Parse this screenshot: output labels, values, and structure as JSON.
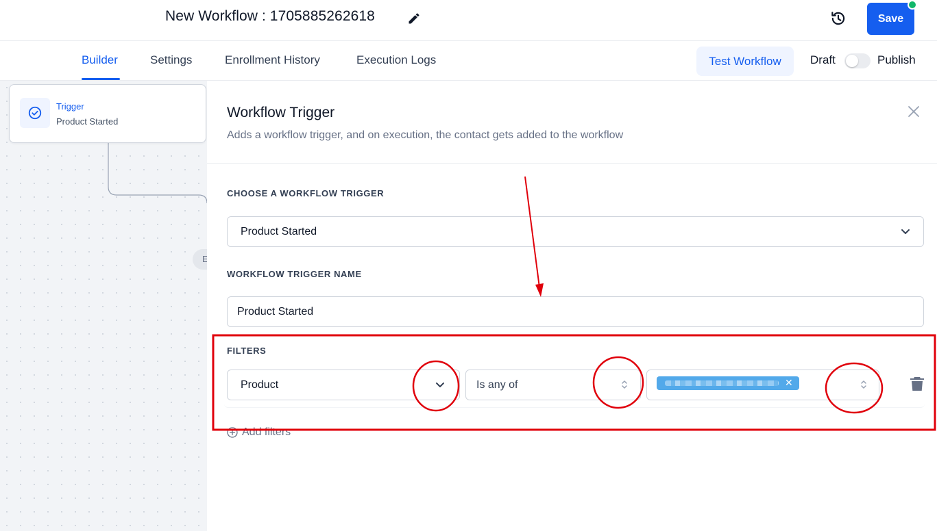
{
  "header": {
    "workflow_title": "New Workflow : 1705885262618",
    "save_label": "Save",
    "edit_icon": "pencil-icon",
    "history_icon": "history-icon"
  },
  "tabs": [
    {
      "label": "Builder",
      "active": true
    },
    {
      "label": "Settings",
      "active": false
    },
    {
      "label": "Enrollment History",
      "active": false
    },
    {
      "label": "Execution Logs",
      "active": false
    }
  ],
  "toolbar": {
    "test_workflow_label": "Test Workflow",
    "draft_label": "Draft",
    "publish_label": "Publish",
    "published": false
  },
  "canvas": {
    "trigger_node": {
      "title": "Trigger",
      "subtitle": "Product Started",
      "icon": "check-circle-icon"
    },
    "next_node_pill": "E"
  },
  "panel": {
    "title": "Workflow Trigger",
    "description": "Adds a workflow trigger, and on execution, the contact gets added to the workflow",
    "choose_trigger_label": "CHOOSE A WORKFLOW TRIGGER",
    "choose_trigger_value": "Product Started",
    "trigger_name_label": "WORKFLOW TRIGGER NAME",
    "trigger_name_value": "Product Started",
    "filters_label": "FILTERS",
    "filter": {
      "field": "Product",
      "operator": "Is any of"
    },
    "add_filters_label": "Add filters"
  },
  "colors": {
    "accent": "#155eef",
    "annotation_red": "#e0000b",
    "status_dot": "#12b76a"
  }
}
